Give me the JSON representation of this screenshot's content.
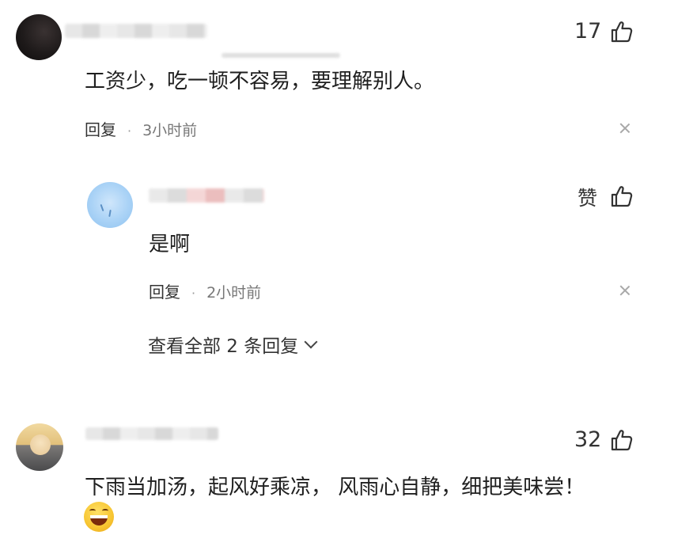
{
  "comments": [
    {
      "text": "工资少，吃一顿不容易，要理解别人。",
      "likes": "17",
      "reply_label": "回复",
      "separator": "·",
      "time": "3小时前"
    },
    {
      "text": "是啊",
      "likes": "赞",
      "reply_label": "回复",
      "separator": "·",
      "time": "2小时前"
    },
    {
      "text": "下雨当加汤，起风好乘凉， 风雨心自静，细把美味尝！",
      "likes": "32"
    }
  ],
  "view_all_replies": "查看全部 2 条回复",
  "icons": {
    "like": "thumbs-up-icon",
    "close": "close-icon",
    "expand": "chevron-down-icon",
    "emoji": "grinning-squinting-face-emoji"
  },
  "colors": {
    "text": "#1f1f1f",
    "meta": "#777777",
    "icon": "#333333"
  }
}
